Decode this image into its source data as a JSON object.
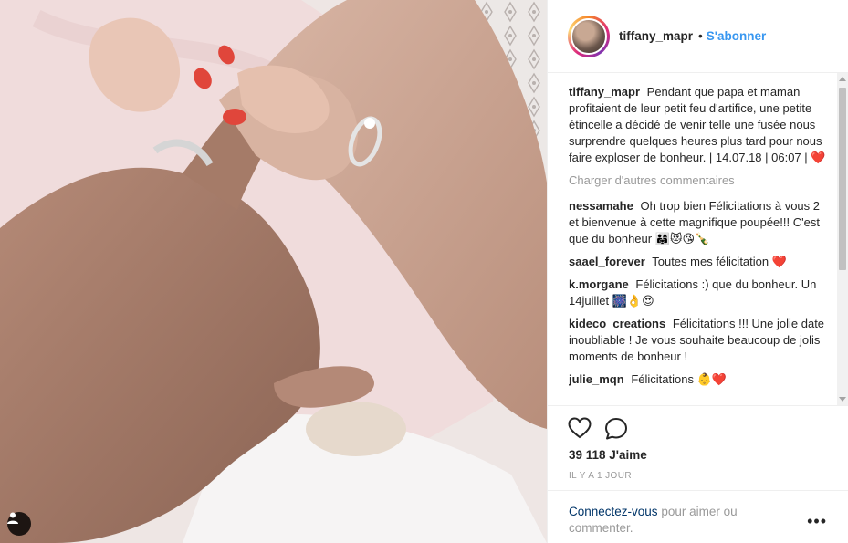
{
  "header": {
    "username": "tiffany_mapr",
    "separator": "•",
    "follow_label": "S'abonner"
  },
  "caption": {
    "username": "tiffany_mapr",
    "text": "Pendant que papa et maman profitaient de leur petit feu d'artifice, une petite étincelle a décidé de venir telle une fusée nous surprendre quelques heures plus tard pour nous faire exploser de bonheur. | 14.07.18 | 06:07 |",
    "emoji": "❤️"
  },
  "load_more_label": "Charger d'autres commentaires",
  "comments": [
    {
      "username": "nessamahe",
      "text": "Oh trop bien Félicitations à vous 2 et bienvenue à cette magnifique poupée!!! C'est que du bonheur",
      "emoji": "👨‍👩‍👧😻😘🍾"
    },
    {
      "username": "saael_forever",
      "text": "Toutes mes félicitation",
      "emoji": "❤️"
    },
    {
      "username": "k.morgane",
      "text": "Félicitations :) que du bonheur. Un 14juillet",
      "emoji": "🎆👌😍"
    },
    {
      "username": "kideco_creations",
      "text": "Félicitations !!! Une jolie date inoubliable ! Je vous souhaite beaucoup de jolis moments de bonheur !",
      "emoji": ""
    },
    {
      "username": "julie_mqn",
      "text": "Félicitations",
      "emoji": "👶❤️"
    }
  ],
  "actions": {
    "like_icon": "heart-outline-icon",
    "comment_icon": "speech-bubble-icon",
    "likes_text": "39 118 J'aime",
    "timestamp": "IL Y A 1 JOUR"
  },
  "login": {
    "link_text": "Connectez-vous",
    "rest_text": " pour aimer ou commenter.",
    "more_label": "•••"
  },
  "colors": {
    "accent_blue": "#3897f0",
    "link_dark": "#003569",
    "muted": "#999999",
    "heart_red": "#e0245e"
  }
}
